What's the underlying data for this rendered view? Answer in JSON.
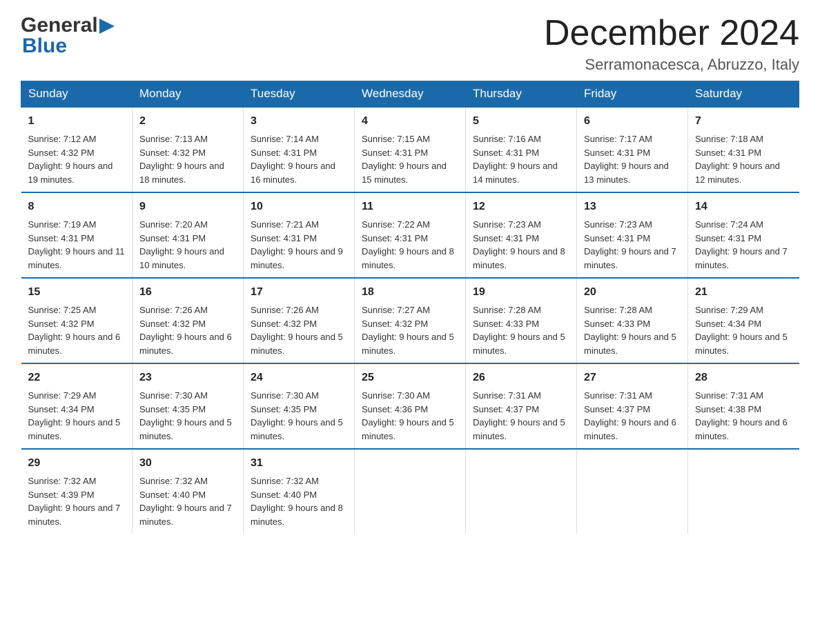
{
  "logo": {
    "line1": "General",
    "arrow": "▶",
    "line2": "Blue"
  },
  "title": "December 2024",
  "subtitle": "Serramonacesca, Abruzzo, Italy",
  "weekdays": [
    "Sunday",
    "Monday",
    "Tuesday",
    "Wednesday",
    "Thursday",
    "Friday",
    "Saturday"
  ],
  "weeks": [
    [
      {
        "day": "1",
        "sunrise": "7:12 AM",
        "sunset": "4:32 PM",
        "daylight": "9 hours and 19 minutes."
      },
      {
        "day": "2",
        "sunrise": "7:13 AM",
        "sunset": "4:32 PM",
        "daylight": "9 hours and 18 minutes."
      },
      {
        "day": "3",
        "sunrise": "7:14 AM",
        "sunset": "4:31 PM",
        "daylight": "9 hours and 16 minutes."
      },
      {
        "day": "4",
        "sunrise": "7:15 AM",
        "sunset": "4:31 PM",
        "daylight": "9 hours and 15 minutes."
      },
      {
        "day": "5",
        "sunrise": "7:16 AM",
        "sunset": "4:31 PM",
        "daylight": "9 hours and 14 minutes."
      },
      {
        "day": "6",
        "sunrise": "7:17 AM",
        "sunset": "4:31 PM",
        "daylight": "9 hours and 13 minutes."
      },
      {
        "day": "7",
        "sunrise": "7:18 AM",
        "sunset": "4:31 PM",
        "daylight": "9 hours and 12 minutes."
      }
    ],
    [
      {
        "day": "8",
        "sunrise": "7:19 AM",
        "sunset": "4:31 PM",
        "daylight": "9 hours and 11 minutes."
      },
      {
        "day": "9",
        "sunrise": "7:20 AM",
        "sunset": "4:31 PM",
        "daylight": "9 hours and 10 minutes."
      },
      {
        "day": "10",
        "sunrise": "7:21 AM",
        "sunset": "4:31 PM",
        "daylight": "9 hours and 9 minutes."
      },
      {
        "day": "11",
        "sunrise": "7:22 AM",
        "sunset": "4:31 PM",
        "daylight": "9 hours and 8 minutes."
      },
      {
        "day": "12",
        "sunrise": "7:23 AM",
        "sunset": "4:31 PM",
        "daylight": "9 hours and 8 minutes."
      },
      {
        "day": "13",
        "sunrise": "7:23 AM",
        "sunset": "4:31 PM",
        "daylight": "9 hours and 7 minutes."
      },
      {
        "day": "14",
        "sunrise": "7:24 AM",
        "sunset": "4:31 PM",
        "daylight": "9 hours and 7 minutes."
      }
    ],
    [
      {
        "day": "15",
        "sunrise": "7:25 AM",
        "sunset": "4:32 PM",
        "daylight": "9 hours and 6 minutes."
      },
      {
        "day": "16",
        "sunrise": "7:26 AM",
        "sunset": "4:32 PM",
        "daylight": "9 hours and 6 minutes."
      },
      {
        "day": "17",
        "sunrise": "7:26 AM",
        "sunset": "4:32 PM",
        "daylight": "9 hours and 5 minutes."
      },
      {
        "day": "18",
        "sunrise": "7:27 AM",
        "sunset": "4:32 PM",
        "daylight": "9 hours and 5 minutes."
      },
      {
        "day": "19",
        "sunrise": "7:28 AM",
        "sunset": "4:33 PM",
        "daylight": "9 hours and 5 minutes."
      },
      {
        "day": "20",
        "sunrise": "7:28 AM",
        "sunset": "4:33 PM",
        "daylight": "9 hours and 5 minutes."
      },
      {
        "day": "21",
        "sunrise": "7:29 AM",
        "sunset": "4:34 PM",
        "daylight": "9 hours and 5 minutes."
      }
    ],
    [
      {
        "day": "22",
        "sunrise": "7:29 AM",
        "sunset": "4:34 PM",
        "daylight": "9 hours and 5 minutes."
      },
      {
        "day": "23",
        "sunrise": "7:30 AM",
        "sunset": "4:35 PM",
        "daylight": "9 hours and 5 minutes."
      },
      {
        "day": "24",
        "sunrise": "7:30 AM",
        "sunset": "4:35 PM",
        "daylight": "9 hours and 5 minutes."
      },
      {
        "day": "25",
        "sunrise": "7:30 AM",
        "sunset": "4:36 PM",
        "daylight": "9 hours and 5 minutes."
      },
      {
        "day": "26",
        "sunrise": "7:31 AM",
        "sunset": "4:37 PM",
        "daylight": "9 hours and 5 minutes."
      },
      {
        "day": "27",
        "sunrise": "7:31 AM",
        "sunset": "4:37 PM",
        "daylight": "9 hours and 6 minutes."
      },
      {
        "day": "28",
        "sunrise": "7:31 AM",
        "sunset": "4:38 PM",
        "daylight": "9 hours and 6 minutes."
      }
    ],
    [
      {
        "day": "29",
        "sunrise": "7:32 AM",
        "sunset": "4:39 PM",
        "daylight": "9 hours and 7 minutes."
      },
      {
        "day": "30",
        "sunrise": "7:32 AM",
        "sunset": "4:40 PM",
        "daylight": "9 hours and 7 minutes."
      },
      {
        "day": "31",
        "sunrise": "7:32 AM",
        "sunset": "4:40 PM",
        "daylight": "9 hours and 8 minutes."
      },
      null,
      null,
      null,
      null
    ]
  ]
}
